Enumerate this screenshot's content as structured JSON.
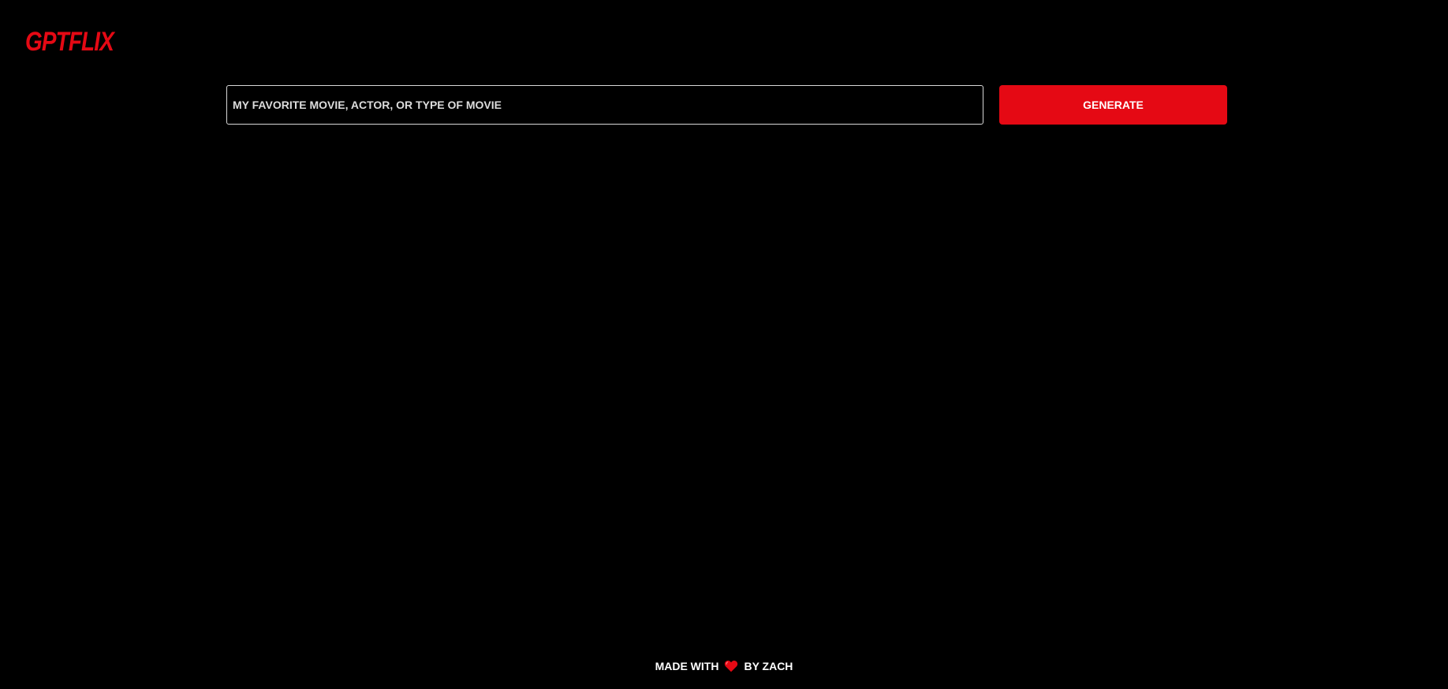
{
  "header": {
    "logo_text": "GPTFLIX"
  },
  "search": {
    "placeholder": "MY FAVORITE MOVIE, ACTOR, OR TYPE OF MOVIE",
    "value": ""
  },
  "actions": {
    "generate_label": "GENERATE"
  },
  "footer": {
    "made_with": "MADE WITH",
    "heart_icon": "heart-icon",
    "by": "BY ZACH"
  },
  "colors": {
    "accent": "#e50914",
    "background": "#000000",
    "text": "#ffffff"
  }
}
